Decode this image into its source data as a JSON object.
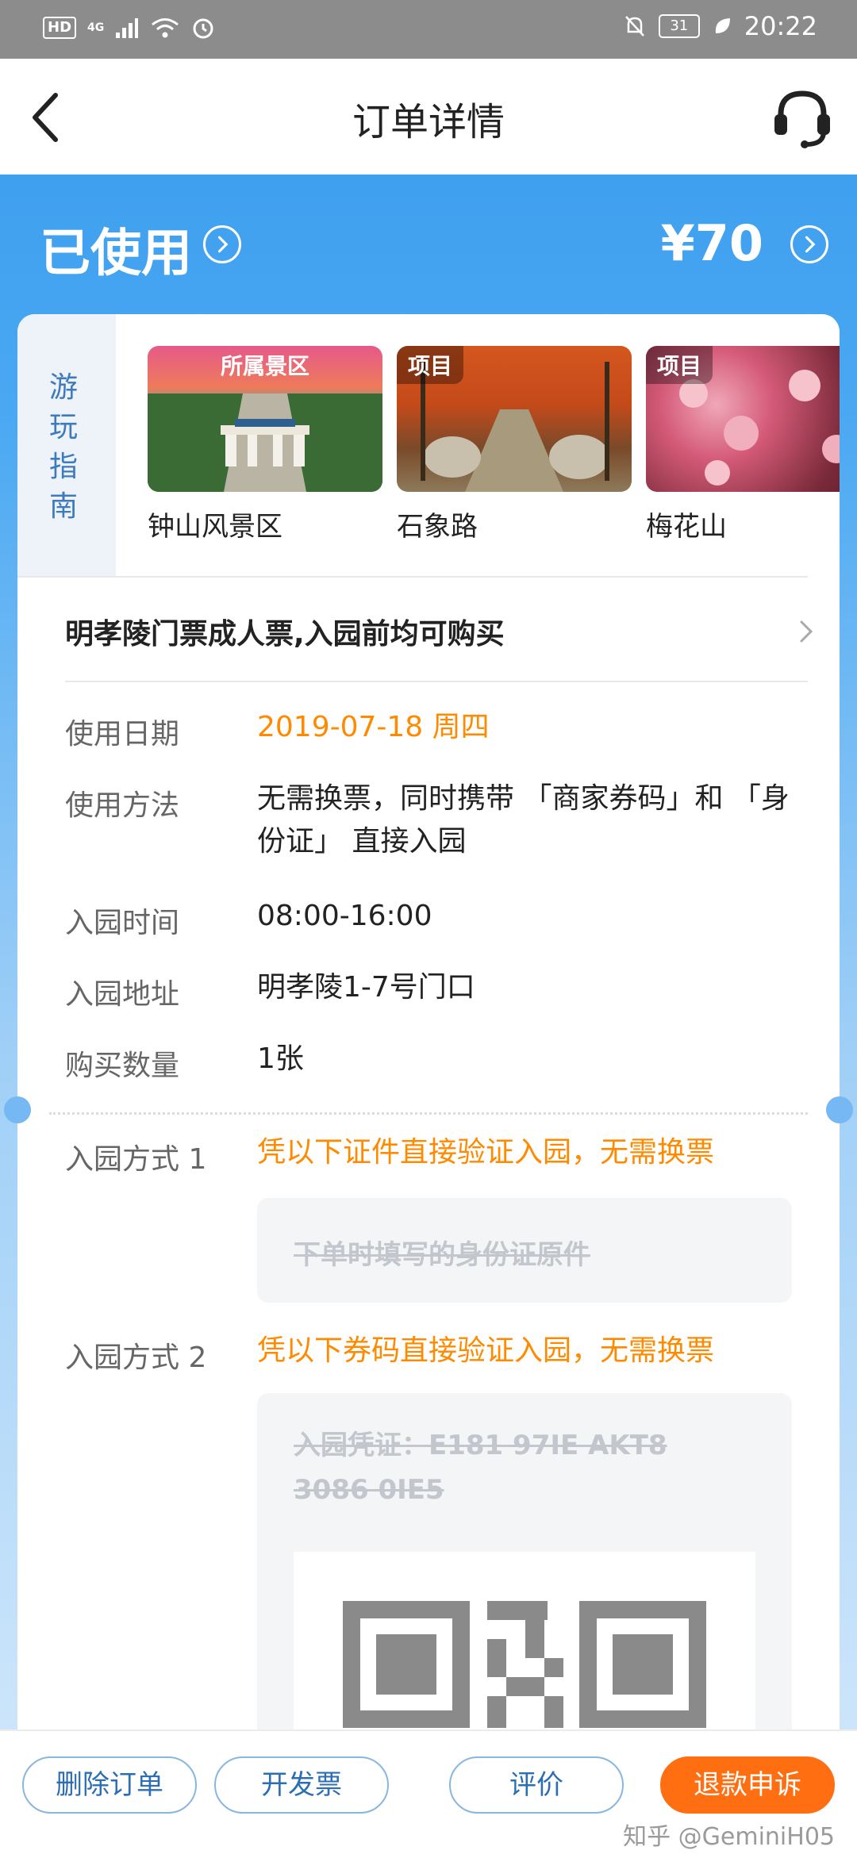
{
  "status_bar": {
    "hd": "HD",
    "network": "4G",
    "battery": "31",
    "time": "20:22"
  },
  "header": {
    "title": "订单详情"
  },
  "summary": {
    "status": "已使用",
    "price": "¥70"
  },
  "guide": {
    "label": "游玩指南",
    "items": [
      {
        "tag": "所属景区",
        "name": "钟山风景区"
      },
      {
        "tag": "项目",
        "name": "石象路"
      },
      {
        "tag": "项目",
        "name": "梅花山"
      }
    ]
  },
  "ticket": {
    "title": "明孝陵门票成人票,入园前均可购买"
  },
  "details": [
    {
      "label": "使用日期",
      "value": "2019-07-18 周四"
    },
    {
      "label": "使用方法",
      "value": "无需换票，同时携带 「商家券码」和 「身份证」 直接入园"
    },
    {
      "label": "入园时间",
      "value": "08:00-16:00"
    },
    {
      "label": "入园地址",
      "value": "明孝陵1-7号门口"
    },
    {
      "label": "购买数量",
      "value": "1张"
    }
  ],
  "entry_methods": [
    {
      "label": "入园方式 1",
      "desc": "凭以下证件直接验证入园，无需换票",
      "box_text": "下单时填写的身份证原件"
    },
    {
      "label": "入园方式 2",
      "desc": "凭以下券码直接验证入园，无需换票",
      "box_text": "入园凭证：E181 97IE AKT8 3086 0IE5"
    }
  ],
  "bottom_actions": {
    "delete": "删除订单",
    "invoice": "开发票",
    "review": "评价",
    "refund": "退款申诉"
  },
  "watermark": "知乎 @GeminiH05",
  "colors": {
    "accent_blue": "#3fa0f0",
    "orange": "#ff8a00",
    "refund_button": "#ff6f12"
  }
}
